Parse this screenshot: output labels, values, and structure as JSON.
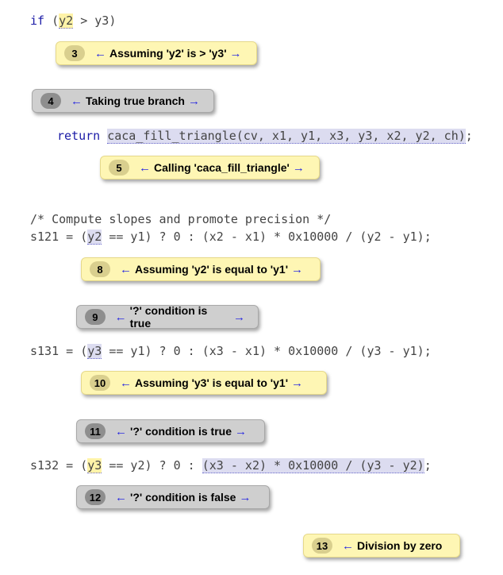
{
  "code": {
    "line1": {
      "a": "if (",
      "b": "y2",
      "c": " > y3)"
    },
    "line2": {
      "kw": "return",
      "call": "caca_fill_triangle(cv, x1, y1, x3, y3, x2, y2, ch)",
      "end": ";"
    },
    "line3": "/* Compute slopes and promote precision */",
    "line4": {
      "a": "s121 = (",
      "b": "y2",
      "c": " == y1) ? 0 : (x2 - x1) * 0x10000 / (y2 - y1);"
    },
    "line5": {
      "a": "s131 = (",
      "b": "y3",
      "c": " == y1) ? 0 : (x3 - x1) * 0x10000 / (y3 - y1);"
    },
    "line6": {
      "a": "s132 = (",
      "b": "y3",
      "c": " == y2) ? 0 : ",
      "d": "(x3 - x2) * 0x10000 / (y3 - y2)",
      "e": ";"
    }
  },
  "arrows": {
    "left": "←",
    "right": "→"
  },
  "events": [
    {
      "num": "3",
      "text": "Assuming 'y2' is > 'y3'"
    },
    {
      "num": "4",
      "text": "Taking true branch"
    },
    {
      "num": "5",
      "text": "Calling 'caca_fill_triangle'"
    },
    {
      "num": "8",
      "text": "Assuming 'y2' is equal to 'y1'"
    },
    {
      "num": "9",
      "text": "'?' condition is true"
    },
    {
      "num": "10",
      "text": "Assuming 'y3' is equal to 'y1'"
    },
    {
      "num": "11",
      "text": "'?' condition is true"
    },
    {
      "num": "12",
      "text": "'?' condition is false"
    },
    {
      "num": "13",
      "text": "Division by zero"
    }
  ]
}
